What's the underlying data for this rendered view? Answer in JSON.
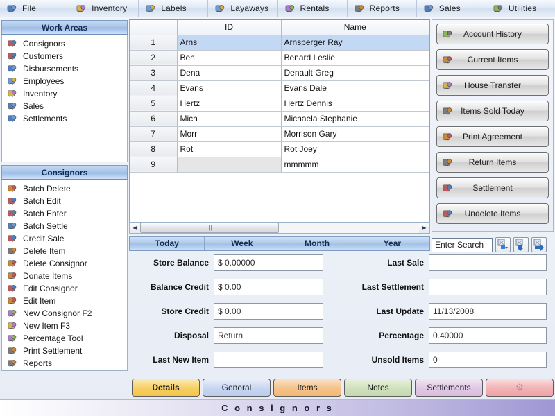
{
  "menubar": {
    "items": [
      {
        "label": "File",
        "icon": "file-icon"
      },
      {
        "label": "Inventory",
        "icon": "inventory-icon"
      },
      {
        "label": "Labels",
        "icon": "labels-icon"
      },
      {
        "label": "Layaways",
        "icon": "layaways-icon"
      },
      {
        "label": "Rentals",
        "icon": "rentals-icon"
      },
      {
        "label": "Reports",
        "icon": "reports-icon"
      },
      {
        "label": "Sales",
        "icon": "sales-icon"
      },
      {
        "label": "Utilities",
        "icon": "utilities-icon"
      }
    ]
  },
  "sidebar": {
    "work_areas": {
      "title": "Work Areas",
      "items": [
        {
          "label": "Consignors",
          "icon": "consignors-icon"
        },
        {
          "label": "Customers",
          "icon": "customers-icon"
        },
        {
          "label": "Disbursements",
          "icon": "disbursements-icon"
        },
        {
          "label": "Employees",
          "icon": "employees-icon"
        },
        {
          "label": "Inventory",
          "icon": "inventory-icon"
        },
        {
          "label": "Sales",
          "icon": "sales-icon"
        },
        {
          "label": "Settlements",
          "icon": "settlements-icon"
        }
      ]
    },
    "consignors": {
      "title": "Consignors",
      "items": [
        {
          "label": "Batch Delete",
          "icon": "batch-delete-icon"
        },
        {
          "label": "Batch Edit",
          "icon": "batch-edit-icon"
        },
        {
          "label": "Batch Enter",
          "icon": "batch-enter-icon"
        },
        {
          "label": "Batch Settle",
          "icon": "batch-settle-icon"
        },
        {
          "label": "Credit Sale",
          "icon": "credit-sale-icon"
        },
        {
          "label": "Delete Item",
          "icon": "delete-item-icon"
        },
        {
          "label": "Delete Consignor",
          "icon": "delete-consignor-icon"
        },
        {
          "label": "Donate Items",
          "icon": "donate-items-icon"
        },
        {
          "label": "Edit Consignor",
          "icon": "edit-consignor-icon"
        },
        {
          "label": "Edit Item",
          "icon": "edit-item-icon"
        },
        {
          "label": "New Consignor  F2",
          "icon": "new-consignor-icon"
        },
        {
          "label": "New Item  F3",
          "icon": "new-item-icon"
        },
        {
          "label": "Percentage Tool",
          "icon": "percentage-tool-icon"
        },
        {
          "label": "Print Settlement",
          "icon": "print-settlement-icon"
        },
        {
          "label": "Reports",
          "icon": "reports-icon"
        }
      ]
    }
  },
  "grid": {
    "columns": [
      "",
      "ID",
      "Name"
    ],
    "rows": [
      {
        "num": "1",
        "id": "Arns",
        "name": "Arnsperger Ray",
        "selected": true
      },
      {
        "num": "2",
        "id": "Ben",
        "name": "Benard Leslie",
        "selected": false
      },
      {
        "num": "3",
        "id": "Dena",
        "name": "Denault Greg",
        "selected": false
      },
      {
        "num": "4",
        "id": "Evans",
        "name": "Evans Dale",
        "selected": false
      },
      {
        "num": "5",
        "id": "Hertz",
        "name": "Hertz Dennis",
        "selected": false
      },
      {
        "num": "6",
        "id": "Mich",
        "name": "Michaela Stephanie",
        "selected": false
      },
      {
        "num": "7",
        "id": "Morr",
        "name": "Morrison Gary",
        "selected": false
      },
      {
        "num": "8",
        "id": "Rot",
        "name": "Rot Joey",
        "selected": false
      },
      {
        "num": "9",
        "id": "",
        "name": "mmmmm",
        "selected": false
      }
    ]
  },
  "action_buttons": [
    {
      "label": "Account History",
      "icon": "account-history-icon"
    },
    {
      "label": "Current Items",
      "icon": "current-items-icon"
    },
    {
      "label": "House Transfer",
      "icon": "house-transfer-icon"
    },
    {
      "label": "Items Sold Today",
      "icon": "items-sold-today-icon"
    },
    {
      "label": "Print Agreement",
      "icon": "print-agreement-icon"
    },
    {
      "label": "Return Items",
      "icon": "return-items-icon"
    },
    {
      "label": "Settlement",
      "icon": "settlement-icon"
    },
    {
      "label": "Undelete Items",
      "icon": "undelete-items-icon"
    }
  ],
  "period_tabs": [
    {
      "label": "Today"
    },
    {
      "label": "Week"
    },
    {
      "label": "Month"
    },
    {
      "label": "Year"
    }
  ],
  "search": {
    "value": "Enter Search",
    "placeholder": "Enter Search",
    "buttons": [
      {
        "icon": "search-find-icon"
      },
      {
        "icon": "search-down-icon"
      },
      {
        "icon": "search-next-icon"
      }
    ]
  },
  "form": {
    "rows": [
      {
        "left_label": "Store Balance",
        "left_value": "$ 0.00000",
        "right_label": "Last Sale",
        "right_value": ""
      },
      {
        "left_label": "Balance Credit",
        "left_value": "$ 0.00",
        "right_label": "Last Settlement",
        "right_value": ""
      },
      {
        "left_label": "Store Credit",
        "left_value": "$ 0.00",
        "right_label": "Last Update",
        "right_value": "11/13/2008"
      },
      {
        "left_label": "Disposal",
        "left_value": "Return",
        "right_label": "Percentage",
        "right_value": "0.40000"
      },
      {
        "left_label": "Last New Item",
        "left_value": "",
        "right_label": "Unsold Items",
        "right_value": "0"
      }
    ]
  },
  "bottom_tabs": [
    {
      "label": "Details",
      "style": "t-details",
      "active": true
    },
    {
      "label": "General",
      "style": "t-general",
      "active": false
    },
    {
      "label": "Items",
      "style": "t-items",
      "active": false
    },
    {
      "label": "Notes",
      "style": "t-notes",
      "active": false
    },
    {
      "label": "Settlements",
      "style": "t-settle",
      "active": false
    },
    {
      "label": "",
      "style": "t-extra",
      "active": false,
      "icon": "gear-icon"
    }
  ],
  "statusbar": {
    "text": "C o n s i g n o r s"
  },
  "colors": {
    "panel_header": "#a9c6ea",
    "selection": "#c3d8f2",
    "statusbar_accent": "#9e97d4",
    "active_tab": "#f6cf63"
  }
}
